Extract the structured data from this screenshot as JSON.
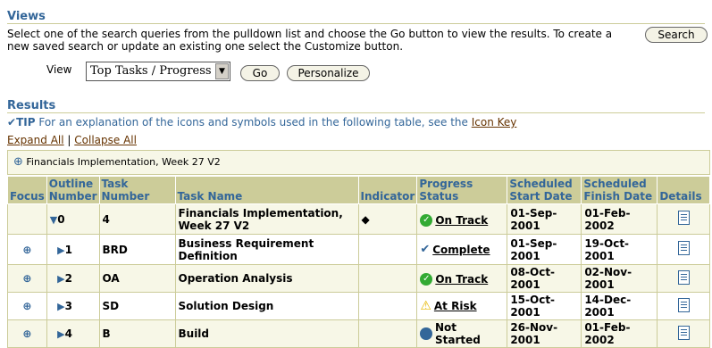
{
  "views": {
    "heading": "Views",
    "description": "Select one of the search queries from the pulldown list and choose the Go button to view the results. To create a new saved search or update an existing one select the Customize button.",
    "search_label": "Search",
    "view_label": "View",
    "view_selected": "Top Tasks / Progress",
    "go_label": "Go",
    "personalize_label": "Personalize"
  },
  "results": {
    "heading": "Results",
    "tip_label": "TIP",
    "tip_text": "For an explanation of the icons and symbols used in the following table, see the",
    "icon_key_label": "Icon Key",
    "expand_all": "Expand All",
    "separator": "|",
    "collapse_all": "Collapse All",
    "breadcrumb": "Financials Implementation, Week 27 V2",
    "columns": [
      "Focus",
      "Outline Number",
      "Task Number",
      "Task Name",
      "Indicator",
      "Progress Status",
      "Scheduled Start Date",
      "Scheduled Finish Date",
      "Details"
    ],
    "rows": [
      {
        "outline": "0",
        "task_number": "4",
        "task_name": "Financials Implementation, Week 27 V2",
        "indicator": "◆",
        "status": "On Track",
        "start": "01-Sep-2001",
        "finish": "01-Feb-2002"
      },
      {
        "outline": "1",
        "task_number": "BRD",
        "task_name": "Business Requirement Definition",
        "indicator": "",
        "status": "Complete",
        "start": "01-Sep-2001",
        "finish": "19-Oct-2001"
      },
      {
        "outline": "2",
        "task_number": "OA",
        "task_name": "Operation Analysis",
        "indicator": "",
        "status": "On Track",
        "start": "08-Oct-2001",
        "finish": "02-Nov-2001"
      },
      {
        "outline": "3",
        "task_number": "SD",
        "task_name": "Solution Design",
        "indicator": "",
        "status": "At Risk",
        "start": "15-Oct-2001",
        "finish": "14-Dec-2001"
      },
      {
        "outline": "4",
        "task_number": "B",
        "task_name": "Build",
        "indicator": "",
        "status": "Not Started",
        "start": "26-Nov-2001",
        "finish": "01-Feb-2002"
      }
    ]
  },
  "colors": {
    "accent": "#336699",
    "header_bg": "#cccc99",
    "link": "#663300"
  }
}
